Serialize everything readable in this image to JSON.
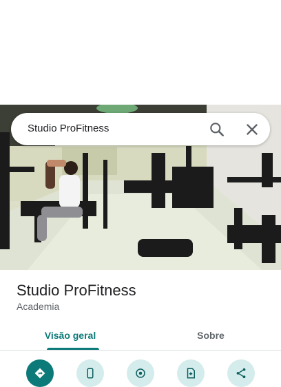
{
  "search": {
    "query": "Studio ProFitness",
    "search_icon": "search-icon",
    "close_icon": "close-icon"
  },
  "place": {
    "title": "Studio ProFitness",
    "category": "Academia"
  },
  "tabs": [
    {
      "label": "Visão geral",
      "active": true
    },
    {
      "label": "Sobre",
      "active": false
    }
  ],
  "actions": [
    {
      "icon": "directions-icon",
      "style": "primary"
    },
    {
      "icon": "phone-icon",
      "style": "secondary"
    },
    {
      "icon": "start-navigation-icon",
      "style": "secondary"
    },
    {
      "icon": "save-icon",
      "style": "secondary"
    },
    {
      "icon": "share-icon",
      "style": "secondary"
    }
  ],
  "colors": {
    "accent": "#0b7a78",
    "action_secondary_bg": "#d5ecec",
    "text_primary": "#202124",
    "text_secondary": "#5f6368"
  }
}
